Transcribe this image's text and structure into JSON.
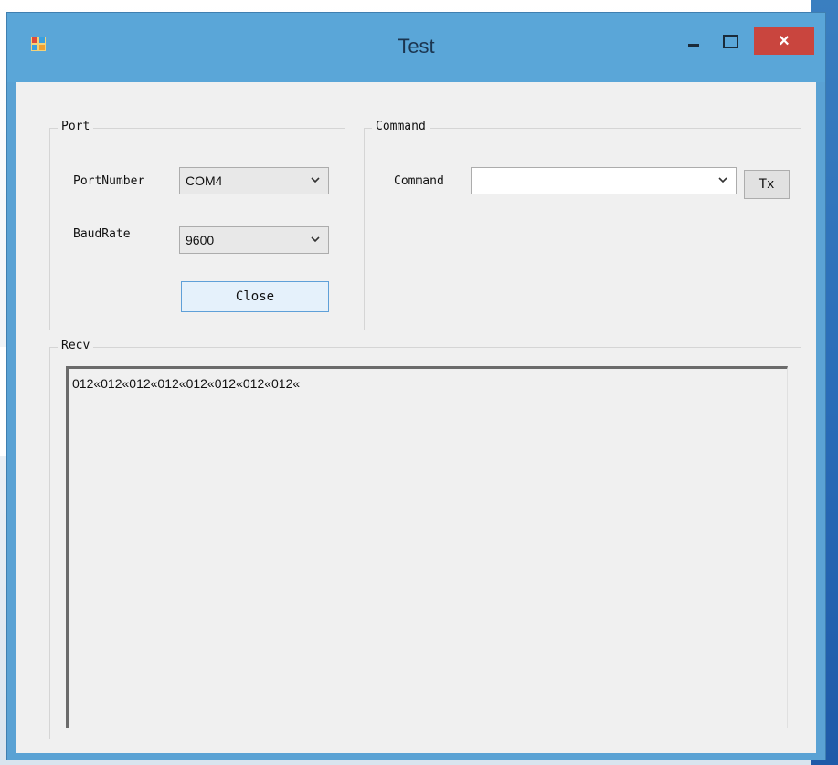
{
  "window": {
    "title": "Test",
    "close_glyph": "×"
  },
  "port": {
    "group_label": "Port",
    "port_number_label": "PortNumber",
    "port_number_value": "COM4",
    "baud_rate_label": "BaudRate",
    "baud_rate_value": "9600",
    "close_button_label": "Close"
  },
  "command": {
    "group_label": "Command",
    "command_label": "Command",
    "command_value": "",
    "send_button_label": "Tx"
  },
  "recv": {
    "group_label": "Recv",
    "text": "012«012«012«012«012«012«012«012«"
  },
  "icons": {
    "app": "app-icon",
    "dropdown": "chevron-down-icon",
    "minimize": "minimize-icon",
    "maximize": "maximize-icon",
    "close": "close-icon"
  },
  "colors": {
    "titlebar": "#5aa6d8",
    "close_button": "#c9453e",
    "client": "#f0f0f0"
  }
}
